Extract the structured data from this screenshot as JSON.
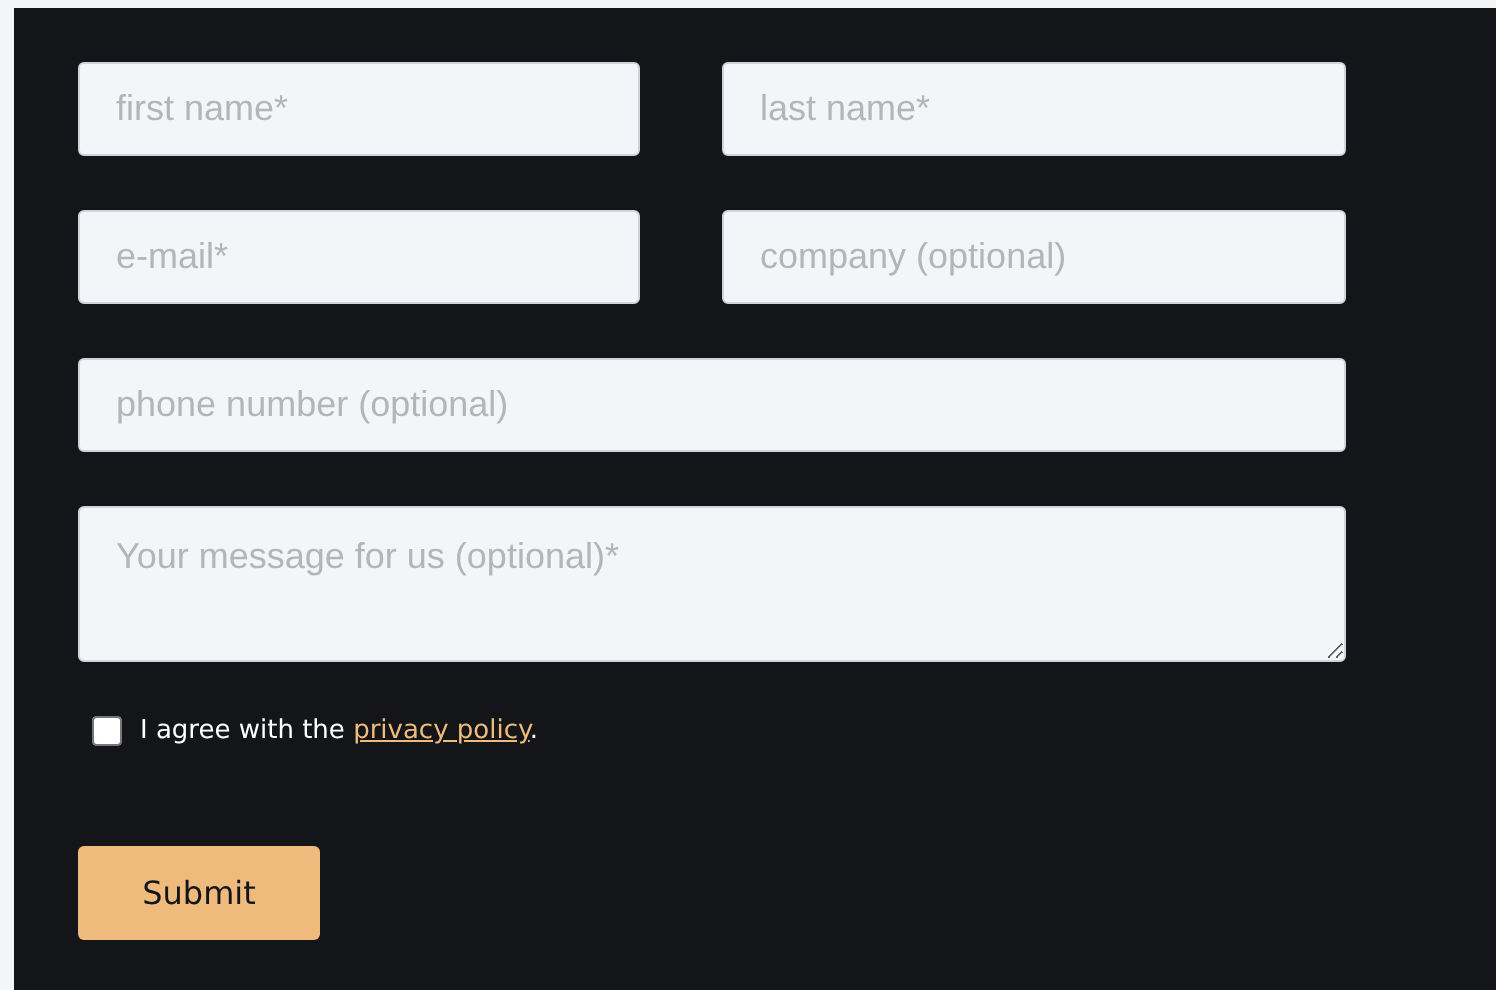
{
  "form_rows": [
    {
      "fields": [
        {
          "kind": "input",
          "placeholder": "first name*"
        },
        {
          "kind": "input",
          "placeholder": "last name*"
        }
      ]
    },
    {
      "fields": [
        {
          "kind": "input",
          "placeholder": "e-mail*"
        },
        {
          "kind": "input",
          "placeholder": "company (optional)"
        }
      ]
    },
    {
      "fields": [
        {
          "kind": "input",
          "placeholder": "phone number (optional)"
        }
      ]
    },
    {
      "fields": [
        {
          "kind": "textarea",
          "placeholder": "Your message for us (optional)*"
        }
      ]
    }
  ],
  "consent": {
    "checked": false,
    "text_before": "I agree with the",
    "link": "privacy policy",
    "text_after": "."
  },
  "submit": {
    "label": "Submit"
  }
}
